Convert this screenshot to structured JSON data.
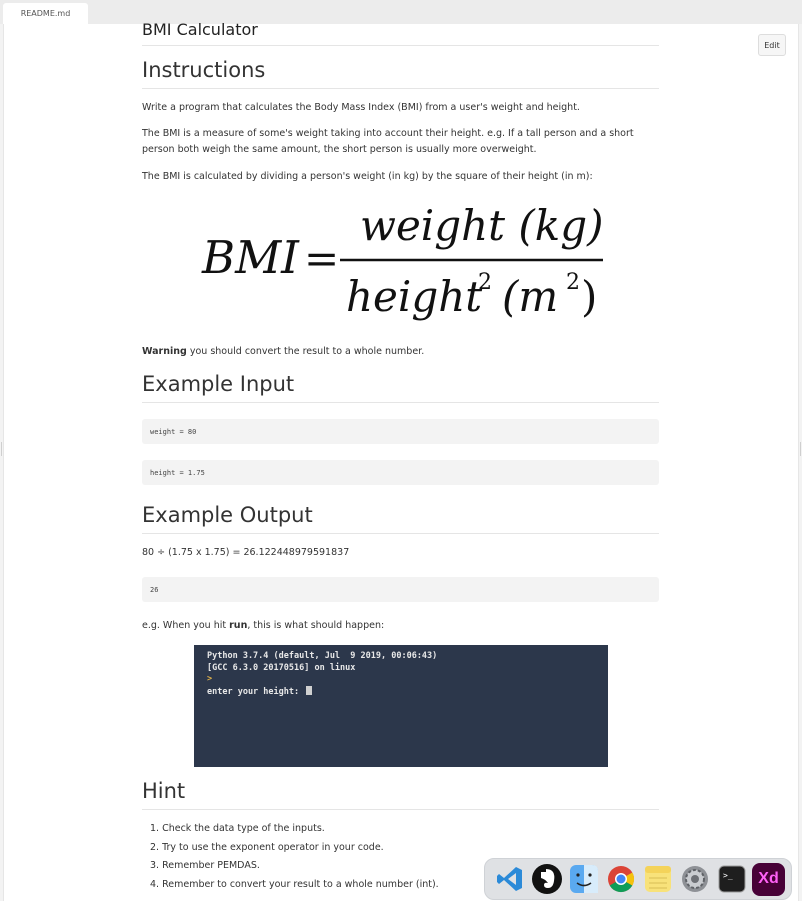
{
  "tab": {
    "label": "README.md"
  },
  "edit_button": {
    "label": "Edit"
  },
  "doc": {
    "title": "BMI Calculator",
    "instructions": {
      "heading": "Instructions",
      "p1": "Write a program that calculates the Body Mass Index (BMI) from a user's weight and height.",
      "p2": "The BMI is a measure of some's weight taking into account their height. e.g. If a tall person and a short person both weigh the same amount, the short person is usually more overweight.",
      "p3": "The BMI is calculated by dividing a person's weight (in kg) by the square of their height (in m):"
    },
    "formula": {
      "lhs": "BMI",
      "eq": "=",
      "numerator": "weight (kg)",
      "denominator_word": "height",
      "denominator_exp": "2",
      "denominator_unit": "(m",
      "denominator_unit_exp": "2",
      "denominator_close": ")"
    },
    "warning": {
      "bold": "Warning",
      "text": " you should convert the result to a whole number."
    },
    "example_input": {
      "heading": "Example Input",
      "code1": "weight = 80",
      "code2": "height = 1.75"
    },
    "example_output": {
      "heading": "Example Output",
      "calc": "80 ÷ (1.75 x 1.75) = 26.122448979591837",
      "code": "26"
    },
    "run_note": {
      "pre": "e.g. When you hit ",
      "bold": "run",
      "post": ", this is what should happen:"
    },
    "terminal": {
      "line1": "Python 3.7.4 (default, Jul  9 2019, 00:06:43)",
      "line2": "[GCC 6.3.0 20170516] on linux",
      "prompt": ">",
      "line4": "enter your height: "
    },
    "hint": {
      "heading": "Hint",
      "items": [
        "1. Check the data type of the inputs.",
        "2. Try to use the exponent operator in your code.",
        "3. Remember PEMDAS.",
        "4. Remember to convert your result to a whole number (int)."
      ]
    }
  },
  "dock": {
    "apps": [
      "vscode-icon",
      "evernote-icon",
      "finder-icon",
      "chrome-icon",
      "notes-icon",
      "system-preferences-icon",
      "terminal-icon",
      "adobe-xd-icon"
    ],
    "xd_label": "Xd",
    "terminal_label": ">_"
  }
}
